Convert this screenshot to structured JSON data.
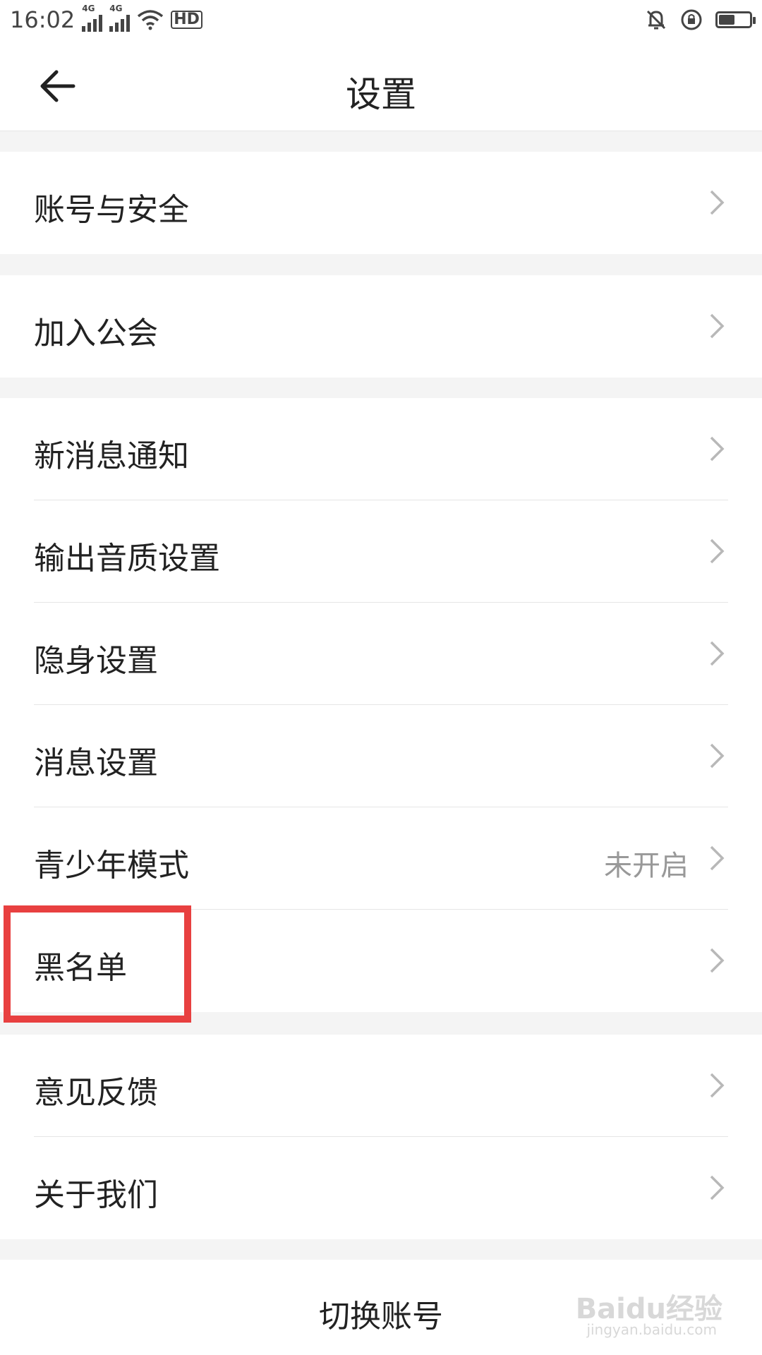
{
  "status_bar": {
    "time": "16:02",
    "network_1": "4G",
    "network_2": "4G",
    "hd_badge": "HD",
    "icons": [
      "signal-icon",
      "wifi-icon",
      "mute-bell-icon",
      "rotation-lock-icon",
      "battery-icon"
    ],
    "battery_level": 0.55
  },
  "header": {
    "title": "设置"
  },
  "groups": [
    {
      "items": [
        {
          "label": "账号与安全"
        }
      ]
    },
    {
      "items": [
        {
          "label": "加入公会"
        }
      ]
    },
    {
      "items": [
        {
          "label": "新消息通知"
        },
        {
          "label": "输出音质设置"
        },
        {
          "label": "隐身设置"
        },
        {
          "label": "消息设置"
        },
        {
          "label": "青少年模式",
          "value": "未开启"
        },
        {
          "label": "黑名单"
        }
      ]
    },
    {
      "items": [
        {
          "label": "意见反馈"
        },
        {
          "label": "关于我们"
        }
      ]
    }
  ],
  "footer": {
    "switch_account_label": "切换账号"
  },
  "watermark": {
    "brand": "Baidu经验",
    "url": "jingyan.baidu.com"
  },
  "colors": {
    "highlight": "#e84040",
    "background": "#f4f4f4",
    "chevron": "#b8b8b8"
  }
}
